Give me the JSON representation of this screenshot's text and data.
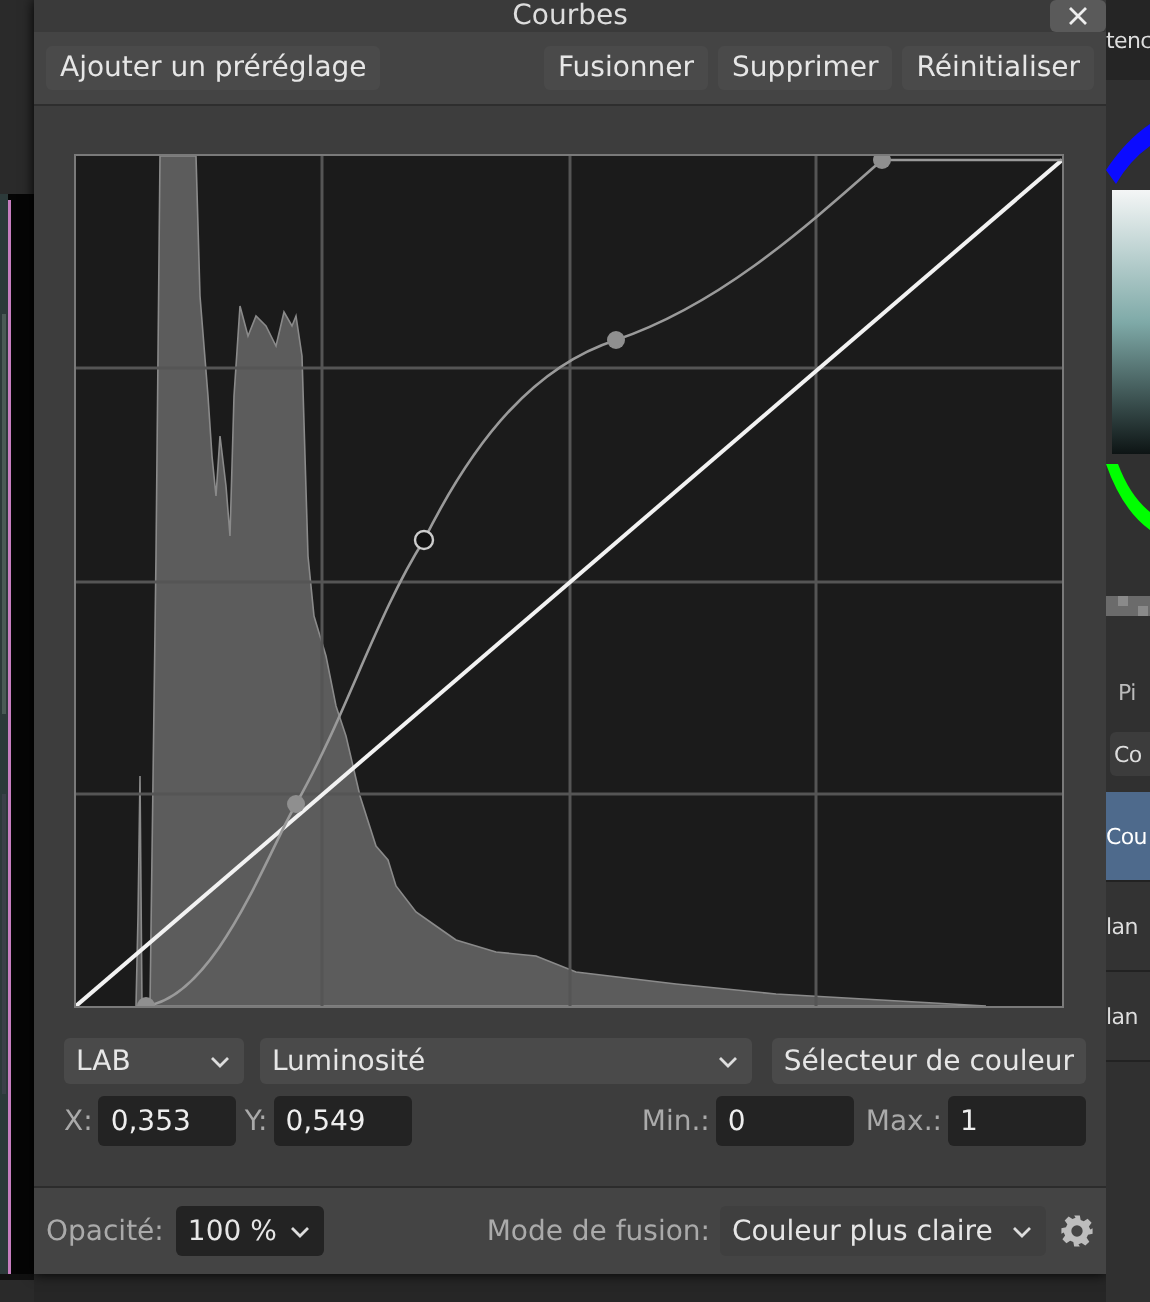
{
  "dialog": {
    "title": "Courbes",
    "toolbar": {
      "preset": "Ajouter un préréglage",
      "buttons": [
        "Fusionner",
        "Supprimer",
        "Réinitialiser"
      ]
    },
    "color_space": "LAB",
    "channel": "Luminosité",
    "picker": "Sélecteur de couleur",
    "fields": [
      {
        "label": "X:",
        "value": "0,353"
      },
      {
        "label": "Y:",
        "value": "0,549"
      },
      {
        "label": "Min.:",
        "value": "0"
      },
      {
        "label": "Max.:",
        "value": "1"
      }
    ],
    "footer": {
      "opacity_label": "Opacité:",
      "opacity": "100 %",
      "blend_label": "Mode de fusion:",
      "blend": "Couleur plus claire"
    }
  },
  "side_panel": {
    "tab": "tenc",
    "heading": "Pi",
    "button": "Co",
    "rows": [
      {
        "label": "Cou",
        "selected": true
      },
      {
        "label": "lan",
        "selected": false
      },
      {
        "label": "lan",
        "selected": false
      }
    ]
  }
}
